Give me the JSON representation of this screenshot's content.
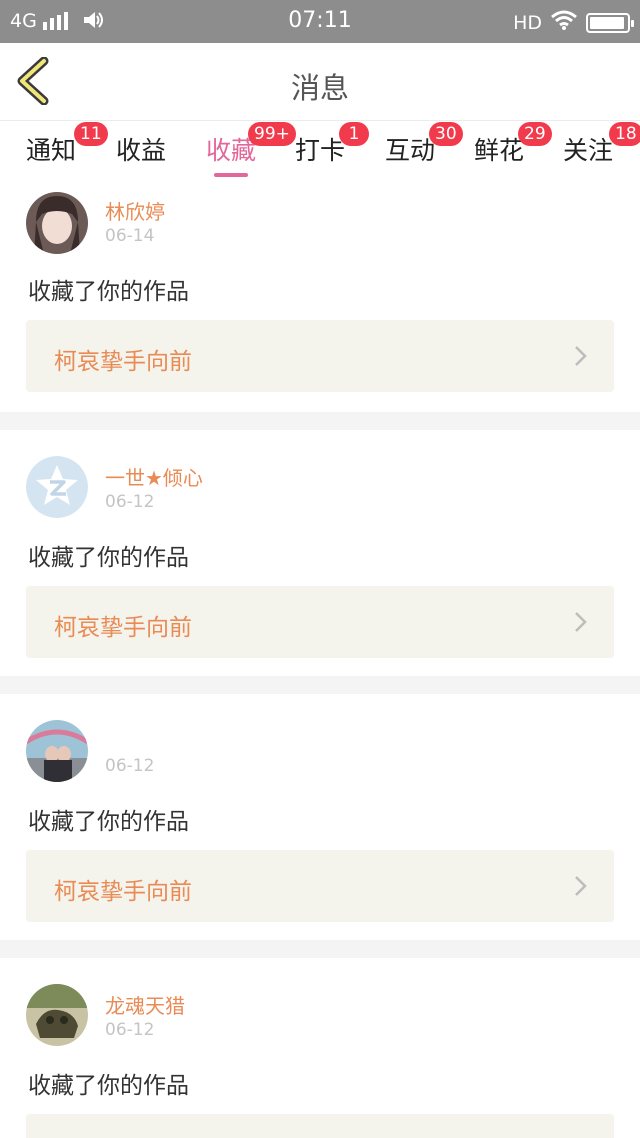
{
  "status_bar": {
    "network": "4G",
    "time": "07:11",
    "hd": "HD",
    "battery_level": 0.95
  },
  "header": {
    "title": "消息"
  },
  "tabs": [
    {
      "label": "通知",
      "badge": "11"
    },
    {
      "label": "收益",
      "badge": ""
    },
    {
      "label": "收藏",
      "badge": "99+",
      "active": true
    },
    {
      "label": "打卡",
      "badge": "1"
    },
    {
      "label": "互动",
      "badge": "30"
    },
    {
      "label": "鲜花",
      "badge": "29"
    },
    {
      "label": "关注",
      "badge": "18"
    }
  ],
  "messages": [
    {
      "user": "林欣婷",
      "date": "06-14",
      "action": "收藏了你的作品",
      "work": "柯哀挚手向前"
    },
    {
      "user": "一世★倾心",
      "date": "06-12",
      "action": "收藏了你的作品",
      "work": "柯哀挚手向前"
    },
    {
      "user": "",
      "date": "06-12",
      "action": "收藏了你的作品",
      "work": "柯哀挚手向前"
    },
    {
      "user": "龙魂天猎",
      "date": "06-12",
      "action": "收藏了你的作品",
      "work": ""
    }
  ],
  "colors": {
    "accent": "#e2679a",
    "badge": "#f23a4d",
    "name": "#e98b55",
    "card_bg": "#f4f3ec"
  }
}
